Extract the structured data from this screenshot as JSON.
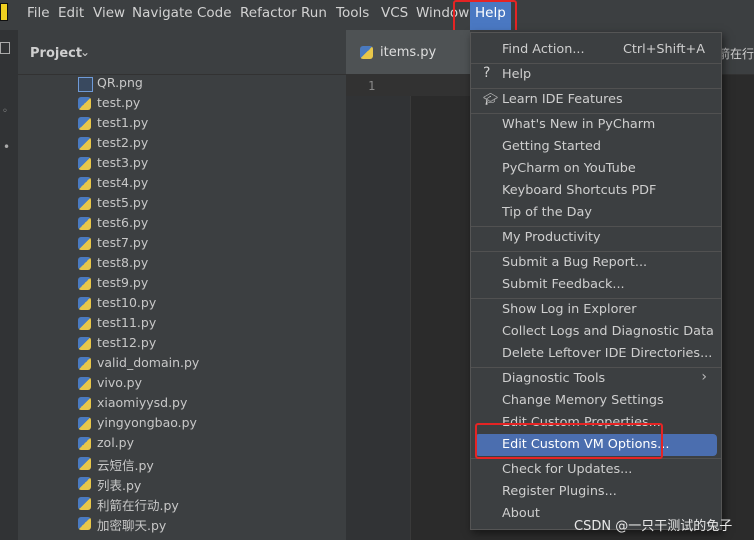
{
  "menubar": {
    "items": [
      "File",
      "Edit",
      "View",
      "Navigate",
      "Code",
      "Refactor",
      "Run",
      "Tools",
      "VCS",
      "Window"
    ],
    "help": "Help"
  },
  "project": {
    "title": "Project"
  },
  "tree": [
    {
      "name": "QR.png",
      "type": "png"
    },
    {
      "name": "test.py",
      "type": "py"
    },
    {
      "name": "test1.py",
      "type": "py"
    },
    {
      "name": "test2.py",
      "type": "py"
    },
    {
      "name": "test3.py",
      "type": "py"
    },
    {
      "name": "test4.py",
      "type": "py"
    },
    {
      "name": "test5.py",
      "type": "py"
    },
    {
      "name": "test6.py",
      "type": "py"
    },
    {
      "name": "test7.py",
      "type": "py"
    },
    {
      "name": "test8.py",
      "type": "py"
    },
    {
      "name": "test9.py",
      "type": "py"
    },
    {
      "name": "test10.py",
      "type": "py"
    },
    {
      "name": "test11.py",
      "type": "py"
    },
    {
      "name": "test12.py",
      "type": "py"
    },
    {
      "name": "valid_domain.py",
      "type": "py"
    },
    {
      "name": "vivo.py",
      "type": "py"
    },
    {
      "name": "xiaomiyysd.py",
      "type": "py"
    },
    {
      "name": "yingyongbao.py",
      "type": "py"
    },
    {
      "name": "zol.py",
      "type": "py"
    },
    {
      "name": "云短信.py",
      "type": "py"
    },
    {
      "name": "列表.py",
      "type": "py"
    },
    {
      "name": "利箭在行动.py",
      "type": "py"
    },
    {
      "name": "加密聊天.py",
      "type": "py"
    }
  ],
  "editor": {
    "tab": "items.py",
    "tab_right": "箭在行",
    "line": "1"
  },
  "help_menu": {
    "find_action": "Find Action...",
    "find_action_shortcut": "Ctrl+Shift+A",
    "help": "Help",
    "learn": "Learn IDE Features",
    "whats_new": "What's New in PyCharm",
    "getting_started": "Getting Started",
    "youtube": "PyCharm on YouTube",
    "shortcuts_pdf": "Keyboard Shortcuts PDF",
    "tip": "Tip of the Day",
    "productivity": "My Productivity",
    "bug": "Submit a Bug Report...",
    "feedback": "Submit Feedback...",
    "show_log": "Show Log in Explorer",
    "collect_logs": "Collect Logs and Diagnostic Data",
    "delete_leftover": "Delete Leftover IDE Directories...",
    "diag_tools": "Diagnostic Tools",
    "memory": "Change Memory Settings",
    "custom_props": "Edit Custom Properties...",
    "vm_options": "Edit Custom VM Options...",
    "updates": "Check for Updates...",
    "plugins": "Register Plugins...",
    "about": "About"
  },
  "watermark": "CSDN @一只干测试的兔子",
  "colors": {
    "selection": "#4b6eaf",
    "highlight_box": "#e52424",
    "menubar_active": "#4a78c2"
  }
}
